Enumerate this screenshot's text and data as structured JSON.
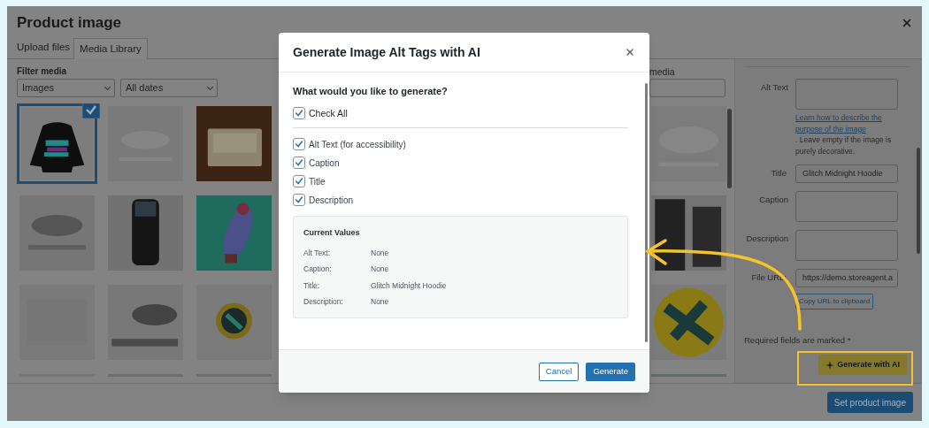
{
  "window": {
    "title": "Product image"
  },
  "tabs": [
    {
      "label": "Upload files",
      "selected": false
    },
    {
      "label": "Media Library",
      "selected": true
    }
  ],
  "filters": {
    "label": "Filter media",
    "type": "Images",
    "date": "All dates"
  },
  "search": {
    "label": "media"
  },
  "media_left": [
    {
      "kind": "picture",
      "selected": true
    },
    {
      "kind": "picture",
      "selected": false
    },
    {
      "kind": "picture",
      "selected": false
    },
    {
      "kind": "picture",
      "selected": false
    },
    {
      "kind": "picture",
      "selected": false
    },
    {
      "kind": "picture",
      "selected": false
    },
    {
      "kind": "picture",
      "selected": false
    },
    {
      "kind": "picture",
      "selected": false
    },
    {
      "kind": "picture",
      "selected": false
    },
    {
      "kind": "picture",
      "selected": false
    },
    {
      "kind": "picture",
      "selected": false
    },
    {
      "kind": "picture",
      "selected": false
    }
  ],
  "media_right": [
    {
      "kind": "picture",
      "selected": false
    },
    {
      "kind": "picture",
      "selected": false
    },
    {
      "kind": "picture",
      "selected": false
    },
    {
      "kind": "picture",
      "selected": false
    }
  ],
  "details": {
    "fields": [
      {
        "kind": "textarea",
        "label": "Alt Text"
      },
      {
        "kind": "help",
        "link": "Learn how to describe the purpose of the image",
        "text": ". Leave empty if the image is purely decorative."
      },
      {
        "kind": "input",
        "label": "Title",
        "value": "Glitch Midnight Hoodie"
      },
      {
        "kind": "textarea",
        "label": "Caption"
      },
      {
        "kind": "textarea",
        "label": "Description"
      },
      {
        "kind": "input",
        "label": "File URL:",
        "value": "https://demo.storeagent.a"
      },
      {
        "kind": "button",
        "label": "Copy URL to clipboard"
      }
    ],
    "required_note": "Required fields are marked *",
    "ai_button": "Generate with AI"
  },
  "primary_button": "Set product image",
  "dialog": {
    "title": "Generate Image Alt Tags with AI",
    "question": "What would you like to generate?",
    "check_all": {
      "label": "Check All",
      "checked": true
    },
    "options": [
      {
        "label": "Alt Text (for accessibility)",
        "checked": true
      },
      {
        "label": "Caption",
        "checked": true
      },
      {
        "label": "Title",
        "checked": true
      },
      {
        "label": "Description",
        "checked": true
      }
    ],
    "current_values": {
      "title": "Current Values",
      "rows": [
        {
          "label": "Alt Text:",
          "value": "None"
        },
        {
          "label": "Caption:",
          "value": "None"
        },
        {
          "label": "Title:",
          "value": "Glitch Midnight Hoodie"
        },
        {
          "label": "Description:",
          "value": "None"
        }
      ]
    },
    "buttons": [
      {
        "label": "Cancel",
        "kind": "secondary"
      },
      {
        "label": "Generate",
        "kind": "primary"
      }
    ]
  }
}
